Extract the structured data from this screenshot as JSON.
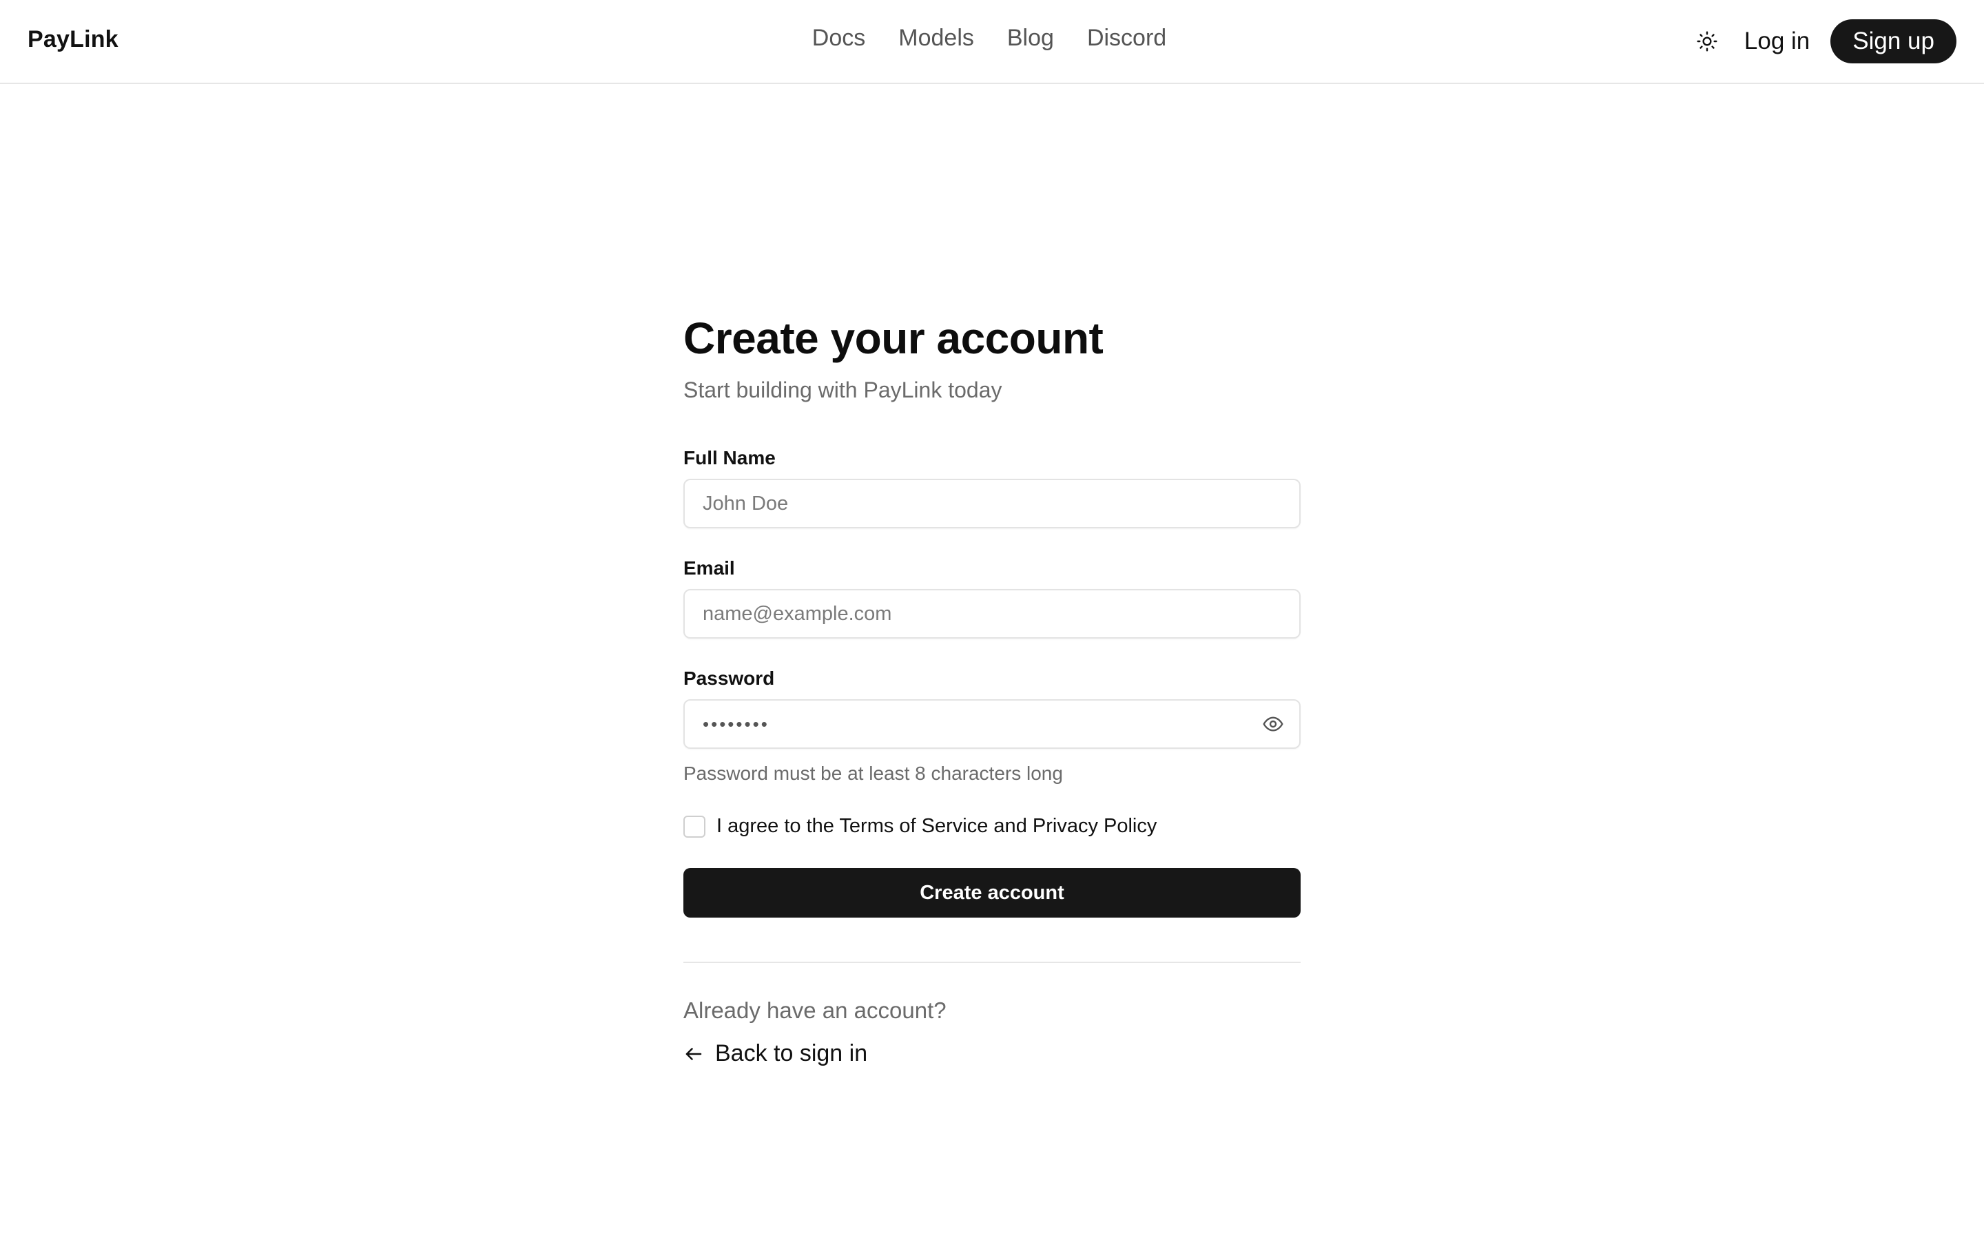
{
  "header": {
    "brand": "PayLink",
    "nav": [
      "Docs",
      "Models",
      "Blog",
      "Discord"
    ],
    "theme_icon": "sun-icon",
    "login_label": "Log in",
    "signup_label": "Sign up"
  },
  "form": {
    "title": "Create your account",
    "subtitle": "Start building with PayLink today",
    "full_name": {
      "label": "Full Name",
      "placeholder": "John Doe"
    },
    "email": {
      "label": "Email",
      "placeholder": "name@example.com"
    },
    "password": {
      "label": "Password",
      "value_masked": "••••••••",
      "toggle_icon": "eye-icon",
      "hint": "Password must be at least 8 characters long"
    },
    "agree_label": "I agree to the Terms of Service and Privacy Policy",
    "submit_label": "Create account",
    "already_text": "Already have an account?",
    "back_label": "Back to sign in",
    "back_icon": "arrow-left-icon"
  },
  "colors": {
    "primary_button": "#171717",
    "muted_text": "#6b6b6b",
    "border": "#e3e3e3"
  }
}
